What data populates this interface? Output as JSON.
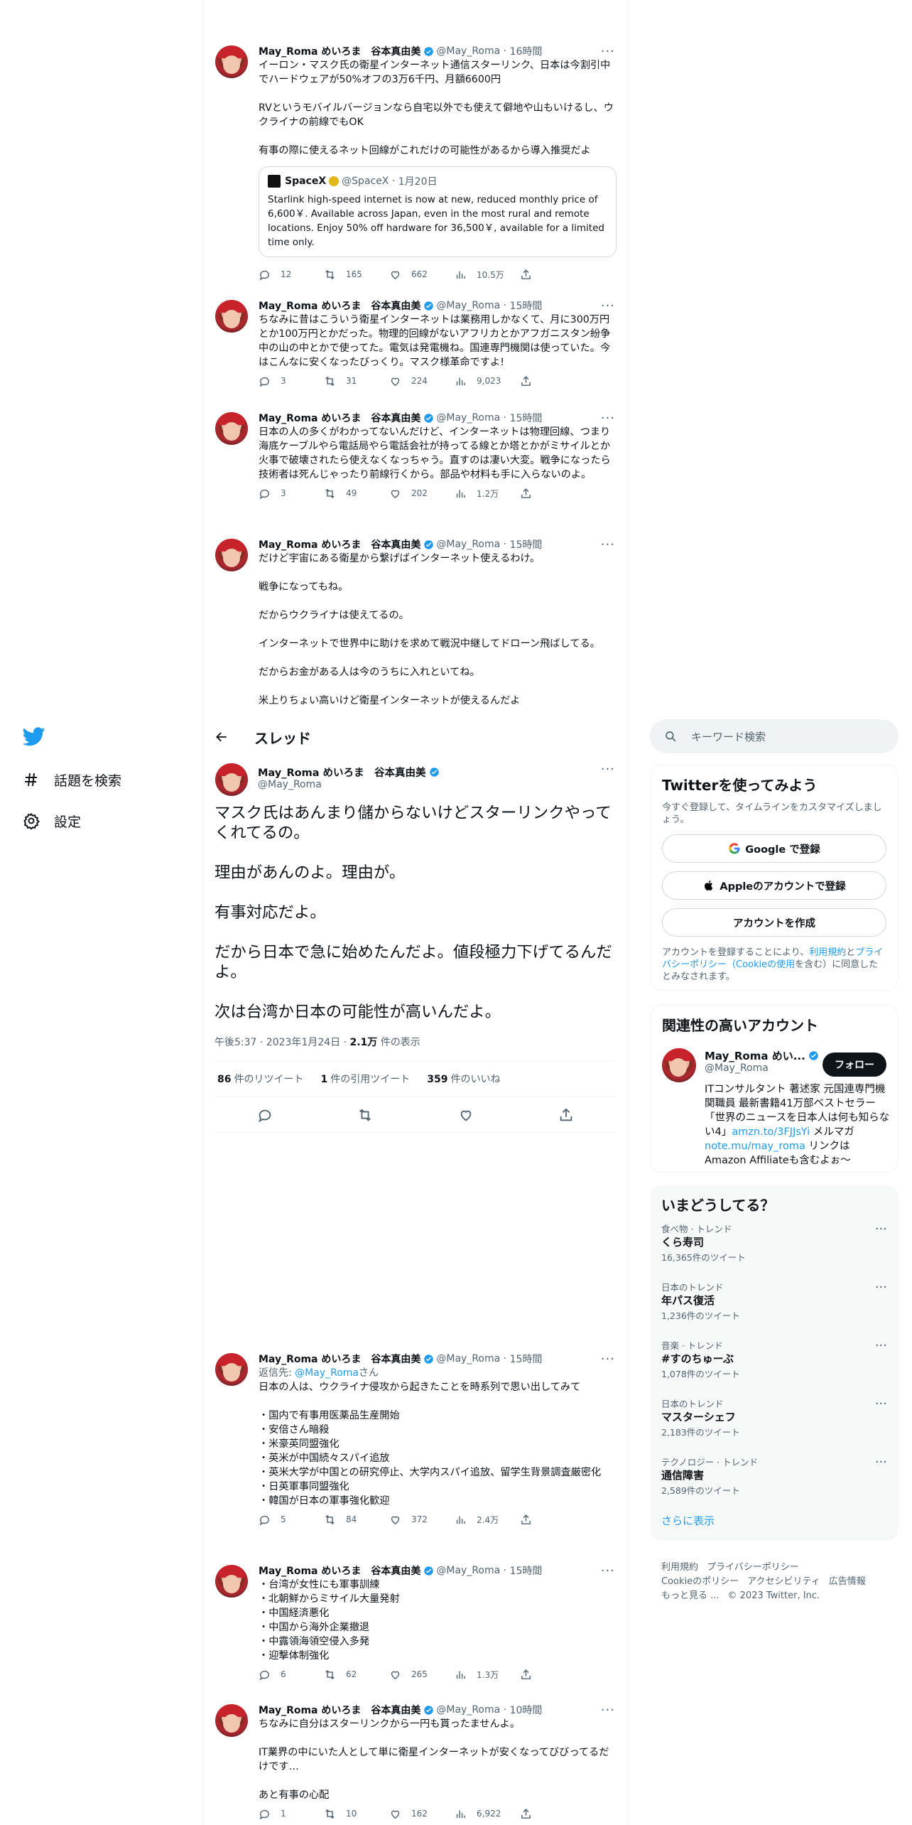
{
  "nav": {
    "explore_label": "話題を検索",
    "settings_label": "設定"
  },
  "thread_header": {
    "title": "スレッド"
  },
  "user": {
    "display_name": "May_Roma めいろま　谷本真由美",
    "handle": "@May_Roma"
  },
  "upper_tweets": [
    {
      "time": "16時間",
      "text": "イーロン・マスク氏の衛星インターネット通信スターリンク、日本は今割引中でハードウェアが50%オフの3万6千円、月額6600円\n\nRVというモバイルバージョンなら自宅以外でも使えて僻地や山もいけるし、ウクライナの前線でもOK\n\n有事の際に使えるネット回線がこれだけの可能性があるから導入推奨だよ",
      "quote": {
        "name": "SpaceX",
        "handle": "@SpaceX",
        "time": "1月20日",
        "text": "Starlink high-speed internet is now at new, reduced monthly price of 6,600￥. Available across Japan, even in the most rural and remote locations. Enjoy 50% off hardware for 36,500￥, available for a limited time only."
      },
      "replies": "12",
      "retweets": "165",
      "likes": "662",
      "views": "10.5万"
    },
    {
      "time": "15時間",
      "text": "ちなみに昔はこういう衛星インターネットは業務用しかなくて、月に300万円とか100万円とかだった。物理的回線がないアフリカとかアフガニスタン紛争中の山の中とかで使ってた。電気は発電機ね。国連専門機関は使っていた。今はこんなに安くなったびっくり。マスク様革命ですよ!",
      "replies": "3",
      "retweets": "31",
      "likes": "224",
      "views": "9,023"
    },
    {
      "time": "15時間",
      "text": "日本の人の多くがわかってないんだけど、インターネットは物理回線、つまり海底ケーブルやら電話局やら電話会社が持ってる線とか塔とかがミサイルとか火事で破壊されたら使えなくなっちゃう。直すのは凄い大変。戦争になったら技術者は死んじゃったり前線行くから。部品や材料も手に入らないのよ。",
      "replies": "3",
      "retweets": "49",
      "likes": "202",
      "views": "1.2万"
    },
    {
      "time": "15時間",
      "text": "だけど宇宙にある衛星から繋げばインターネット使えるわけ。\n\n戦争になってもね。\n\nだからウクライナは使えてるの。\n\nインターネットで世界中に助けを求めて戦況中継してドローン飛ばしてる。\n\nだからお金がある人は今のうちに入れといてね。\n\n米上りちょい高いけど衛星インターネットが使えるんだよ"
    }
  ],
  "main_tweet": {
    "text": "マスク氏はあんまり儲からないけどスターリンクやってくれてるの。\n\n理由があんのよ。理由が。\n\n有事対応だよ。\n\nだから日本で急に始めたんだよ。値段極力下げてるんだよ。\n\n次は台湾か日本の可能性が高いんだよ。",
    "meta_time": "午後5:37 · 2023年1月24日 · ",
    "views_num": "2.1万",
    "views_label": " 件の表示",
    "retweets": "86",
    "retweets_label": "件のリツイート",
    "quotes": "1",
    "quotes_label": "件の引用ツイート",
    "likes": "359",
    "likes_label": "件のいいね"
  },
  "lower_tweets": [
    {
      "time": "15時間",
      "reply_prefix": "返信先: ",
      "reply_handle": "@May_Roma",
      "reply_suffix": "さん",
      "text": "日本の人は、ウクライナ侵攻から起きたことを時系列で思い出してみて\n\n・国内で有事用医薬品生産開始\n・安倍さん暗殺\n・米豪英同盟強化\n・英米が中国続々スパイ追放\n・英米大学が中国との研究停止、大学内スパイ追放、留学生背景調査厳密化\n・日英軍事同盟強化\n・韓国が日本の軍事強化歓迎",
      "replies": "5",
      "retweets": "84",
      "likes": "372",
      "views": "2.4万"
    },
    {
      "time": "15時間",
      "text": "・台湾が女性にも軍事訓練\n・北朝鮮からミサイル大量発射\n・中国経済悪化\n・中国から海外企業撤退\n・中露領海領空侵入多発\n・迎撃体制強化",
      "replies": "6",
      "retweets": "62",
      "likes": "265",
      "views": "1.3万"
    },
    {
      "time": "10時間",
      "text": "ちなみに自分はスターリンクから一円も貰ったませんよ。\n\nIT業界の中にいた人として単に衛星インターネットが安くなってびびってるだけです…\n\nあと有事の心配",
      "replies": "1",
      "retweets": "10",
      "likes": "162",
      "views": "6,922"
    }
  ],
  "sidebar": {
    "search_placeholder": "キーワード検索",
    "signup": {
      "title": "Twitterを使ってみよう",
      "subtitle": "今すぐ登録して、タイムラインをカスタマイズしましょう。",
      "google": "Google で登録",
      "apple": "Appleのアカウントで登録",
      "create": "アカウントを作成",
      "terms_1": "アカウントを登録することにより、",
      "terms_link1": "利用規約",
      "terms_2": "と",
      "terms_link2": "プライバシーポリシー（Cookieの使用",
      "terms_3": "を含む）に同意したとみなされます。"
    },
    "related": {
      "title": "関連性の高いアカウント",
      "name": "May_Roma めい...",
      "handle": "@May_Roma",
      "follow": "フォロー",
      "bio_1": "ITコンサルタント 著述家 元国連専門機関職員 最新書籍41万部ベストセラー「世界のニュースを日本人は何も知らない4」",
      "bio_link1": "amzn.to/3FJJsYi",
      "bio_2": " メルマガ ",
      "bio_link2": "note.mu/may_roma",
      "bio_3": " リンクはAmazon Affiliateも含むよぉ〜"
    },
    "trends": {
      "title": "いまどうしてる？",
      "items": [
        {
          "category": "食べ物 · トレンド",
          "topic": "くら寿司",
          "count": "16,365件のツイート"
        },
        {
          "category": "日本のトレンド",
          "topic": "年パス復活",
          "count": "1,236件のツイート"
        },
        {
          "category": "音楽 · トレンド",
          "topic": "#すのちゅーぶ",
          "count": "1,078件のツイート"
        },
        {
          "category": "日本のトレンド",
          "topic": "マスターシェフ",
          "count": "2,183件のツイート"
        },
        {
          "category": "テクノロジー · トレンド",
          "topic": "通信障害",
          "count": "2,589件のツイート"
        }
      ],
      "show_more": "さらに表示"
    },
    "footer": {
      "l1": "利用規約",
      "l2": "プライバシーポリシー",
      "l3": "Cookieのポリシー",
      "l4": "アクセシビリティ",
      "l5": "広告情報",
      "l6": "もっと見る ...",
      "copyright": "© 2023 Twitter, Inc."
    }
  },
  "colors": {
    "accent": "#1d9bf0",
    "text": "#0f1419",
    "muted": "#536471",
    "border": "#eff3f4"
  }
}
